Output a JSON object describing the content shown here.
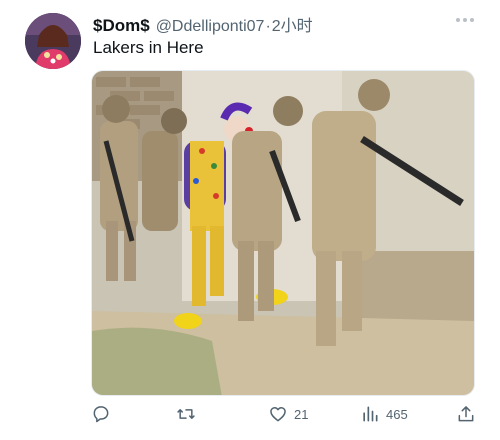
{
  "tweet": {
    "display_name": "$Dom$",
    "handle": "@Ddelliponti07",
    "separator": "·",
    "time": "2小时",
    "text": "Lakers in Here"
  },
  "image": {
    "subject": "soldiers-and-clown-photo"
  },
  "actions": {
    "reply_count": "",
    "retweet_count": "",
    "like_count": "21",
    "view_count": "465"
  },
  "icons": [
    "reply-icon",
    "retweet-icon",
    "like-icon",
    "views-icon",
    "share-icon",
    "more-icon"
  ],
  "colors": {
    "text": "#0f1419",
    "secondary": "#536471"
  }
}
